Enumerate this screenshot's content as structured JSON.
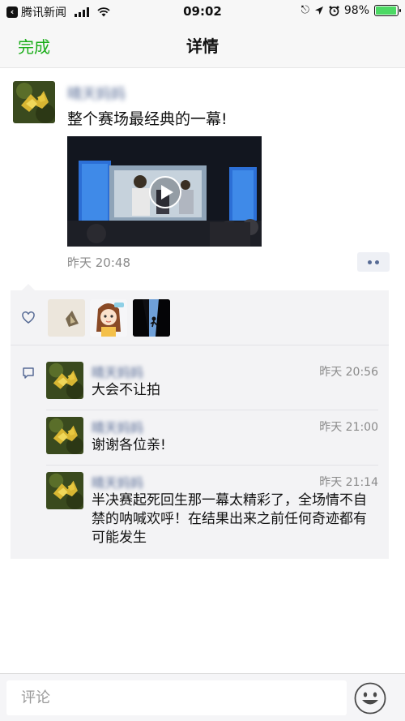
{
  "status_bar": {
    "back_app": "腾讯新闻",
    "time": "09:02",
    "battery": "98%",
    "battery_level": 0.98,
    "icons": [
      "back-arrow-icon",
      "signal-bars-icon",
      "wifi-icon",
      "orientation-lock-icon",
      "location-arrow-icon",
      "alarm-icon",
      "battery-icon"
    ]
  },
  "nav": {
    "done_label": "完成",
    "title": "详情"
  },
  "post": {
    "author": "晴天妈妈",
    "text": "整个赛场最经典的一幕!",
    "time": "昨天 20:48",
    "icons": [
      "play-icon",
      "more-dots-icon"
    ]
  },
  "likes": {
    "icon": "heart-icon",
    "avatars": [
      "like-avatar-1",
      "like-avatar-2",
      "like-avatar-3"
    ]
  },
  "comments": [
    {
      "author": "晴天妈妈",
      "time": "昨天 20:56",
      "text": "大会不让拍"
    },
    {
      "author": "晴天妈妈",
      "time": "昨天 21:00",
      "text": "谢谢各位亲!"
    },
    {
      "author": "晴天妈妈",
      "time": "昨天 21:14",
      "text": "半决赛起死回生那一幕太精彩了，全场情不自禁的呐喊欢呼！在结果出来之前任何奇迹都有可能发生"
    }
  ],
  "comment_icon": "comment-bubble-icon",
  "input": {
    "placeholder": "评论",
    "value": ""
  },
  "emoji_icon": "emoji-face-icon",
  "colors": {
    "accent_green": "#1aad19",
    "link_blue": "#576b95",
    "panel_bg": "#f3f3f5",
    "muted_text": "#8a8a8a"
  }
}
